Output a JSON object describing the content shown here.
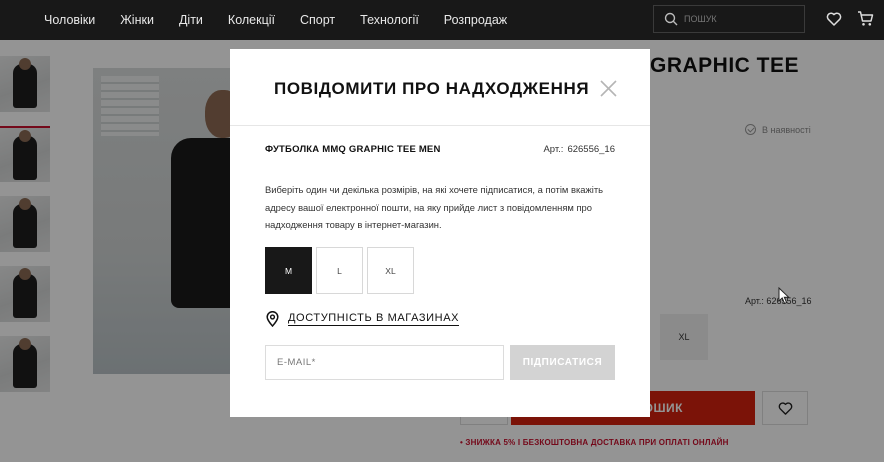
{
  "nav": {
    "links": [
      "Чоловіки",
      "Жінки",
      "Діти",
      "Колекції",
      "Спорт",
      "Технології",
      "Розпродаж"
    ],
    "search_placeholder": "ПОШУК"
  },
  "product_page": {
    "title_fragment": "GRAPHIC TEE",
    "in_stock": "В наявності",
    "article": "Арт.: 626556_16",
    "visible_size": "XL",
    "buy_label": "ОШИК",
    "promo": "• ЗНИЖКА 5% І БЕЗКОШТОВНА ДОСТАВКА ПРИ ОПЛАТІ ОНЛАЙН"
  },
  "modal": {
    "title": "ПОВІДОМИТИ ПРО НАДХОДЖЕННЯ",
    "product_name": "ФУТБОЛКА MMQ GRAPHIC TEE MEN",
    "article_label": "Арт.:",
    "article_value": "626556_16",
    "description": "Виберіть один чи декілька розмірів, на які хочете підписатися, а потім вкажіть адресу вашої електронної пошти, на яку прийде лист з повідомленням про надходження товару в інтернет-магазин.",
    "sizes": [
      {
        "label": "M",
        "selected": true
      },
      {
        "label": "L",
        "selected": false
      },
      {
        "label": "XL",
        "selected": false
      }
    ],
    "stores_link": "ДОСТУПНІСТЬ В МАГАЗИНАХ",
    "email_placeholder": "E-MAIL*",
    "subscribe_label": "ПІДПИСАТИСЯ"
  },
  "colors": {
    "accent_red": "#d4220f",
    "promo_red": "#c8102e",
    "nav_bg": "#181818",
    "selected_size_bg": "#181818",
    "disabled_button": "#d3d3d3"
  }
}
